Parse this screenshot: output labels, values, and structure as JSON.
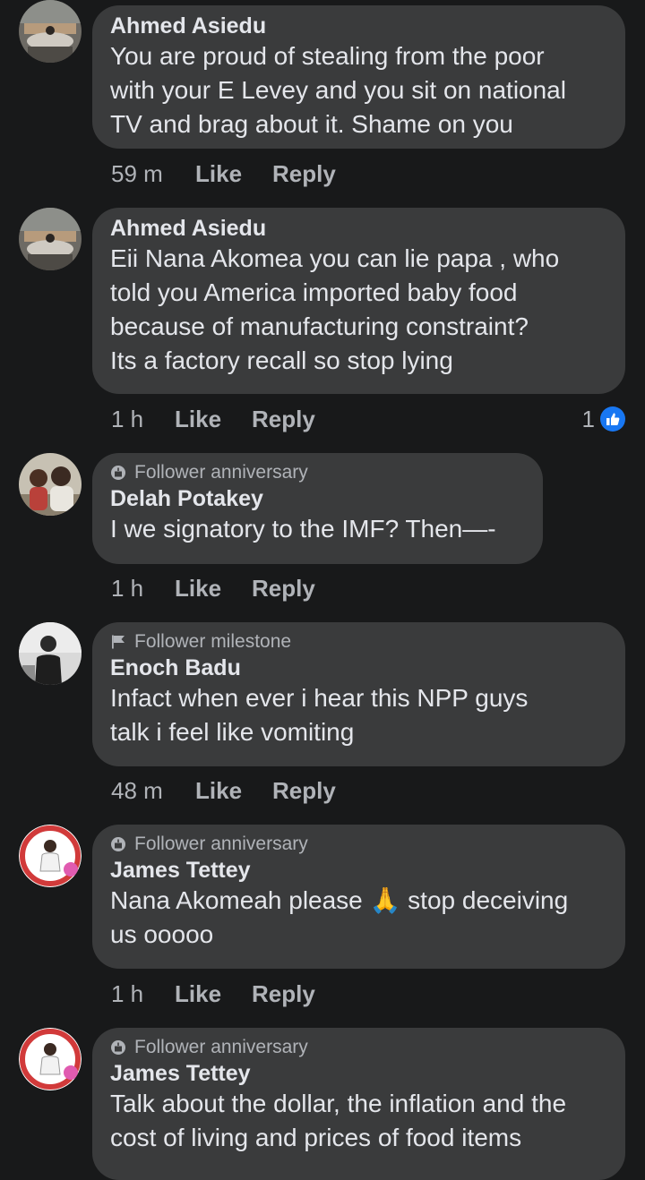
{
  "comments": [
    {
      "author": "Ahmed Asiedu",
      "badge": "",
      "text": "You are proud of stealing from the poor\nwith your E Levey and you sit on national\nTV and brag about it. Shame on you",
      "time": "59 m",
      "like_label": "Like",
      "reply_label": "Reply"
    },
    {
      "author": "Ahmed Asiedu",
      "badge": "",
      "text": "Eii Nana Akomea you can lie papa , who\ntold you America imported baby food\nbecause of manufacturing constraint?\nIts a factory recall so stop lying",
      "time": "1 h",
      "like_label": "Like",
      "reply_label": "Reply",
      "reaction_count": "1",
      "reaction_icon": "thumbs-up-icon"
    },
    {
      "author": "Delah Potakey",
      "badge": "Follower anniversary",
      "badge_icon": "anniversary-icon",
      "text": "I we signatory to the IMF? Then—-",
      "time": "1 h",
      "like_label": "Like",
      "reply_label": "Reply"
    },
    {
      "author": "Enoch Badu",
      "badge": "Follower milestone",
      "badge_icon": "flag-icon",
      "text": "Infact when ever i hear this NPP guys\ntalk i feel like vomiting",
      "time": "48 m",
      "like_label": "Like",
      "reply_label": "Reply"
    },
    {
      "author": "James Tettey",
      "badge": "Follower anniversary",
      "badge_icon": "anniversary-icon",
      "text": "Nana Akomeah please 🙏 stop deceiving\nus ooooo",
      "time": "1 h",
      "like_label": "Like",
      "reply_label": "Reply"
    },
    {
      "author": "James Tettey",
      "badge": "Follower anniversary",
      "badge_icon": "anniversary-icon",
      "text": "Talk about the dollar, the inflation and the\ncost of living and prices of food items",
      "time": "",
      "like_label": "",
      "reply_label": ""
    }
  ],
  "colors": {
    "background": "#18191a",
    "bubble": "#3a3b3c",
    "primary_text": "#e4e6eb",
    "secondary_text": "#b0b3b8",
    "like_badge": "#1877f2"
  }
}
